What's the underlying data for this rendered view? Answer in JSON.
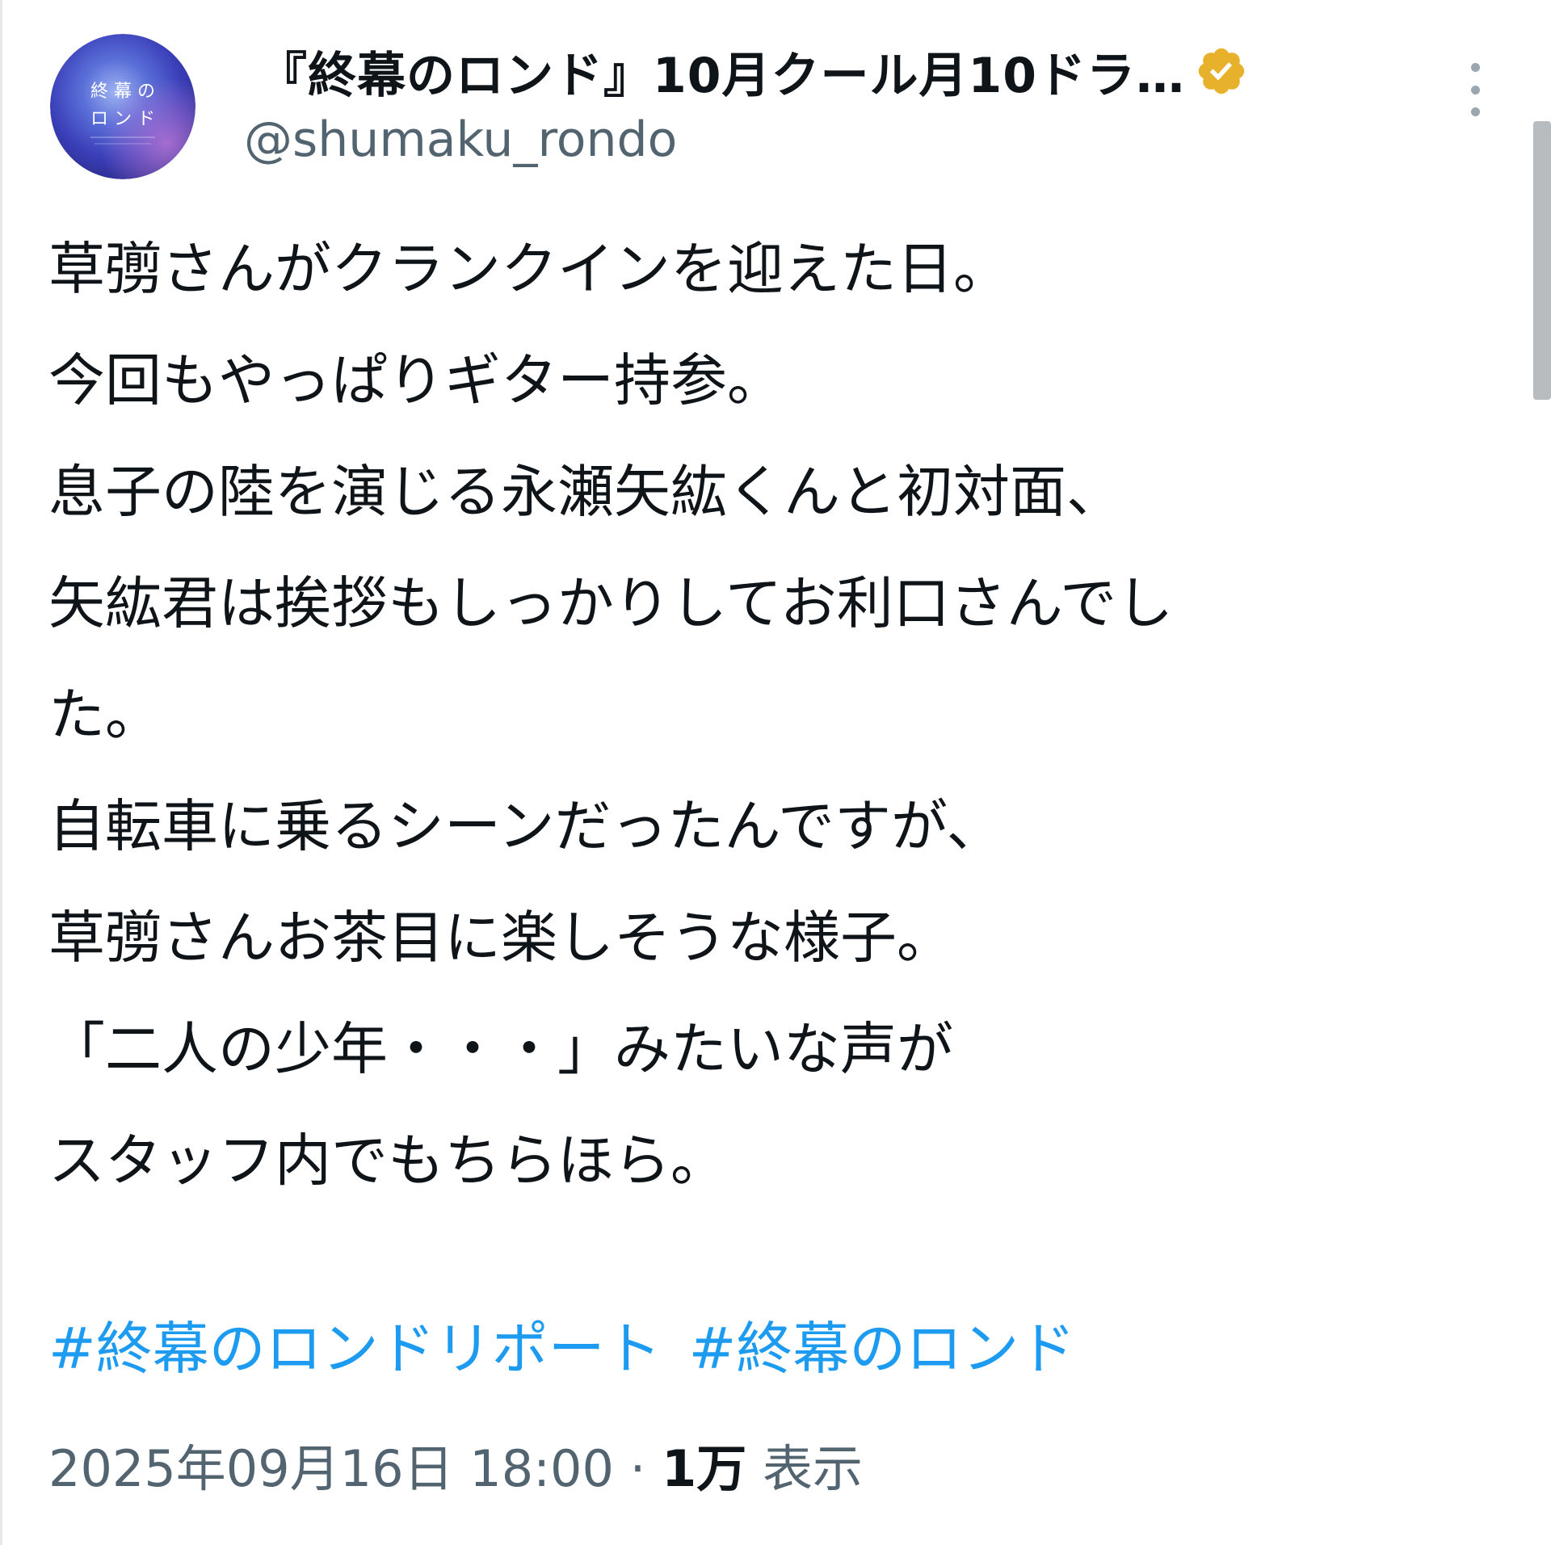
{
  "account": {
    "display_name": "『終幕のロンド』10月クール月10ドラ…",
    "handle": "@shumaku_rondo",
    "verified": true,
    "avatar_text_line1": "終 幕 の",
    "avatar_text_line2": "ロ ン ド"
  },
  "tweet": {
    "lines": [
      "草彅さんがクランクインを迎えた日。",
      "今回もやっぱりギター持参。",
      "息子の陸を演じる永瀬矢紘くんと初対面、",
      "矢紘君は挨拶もしっかりしてお利口さんでし",
      "た。",
      "自転車に乗るシーンだったんですが、",
      "草彅さんお茶目に楽しそうな様子。",
      "「二人の少年・・・」みたいな声が",
      "スタッフ内でもちらほら。"
    ],
    "hashtags": [
      "#終幕のロンドリポート",
      "#終幕のロンド"
    ]
  },
  "meta": {
    "timestamp": "2025年09月16日 18:00",
    "separator": "·",
    "views_count": "1万",
    "views_label": "表示"
  },
  "colors": {
    "text": "#0f1419",
    "secondary": "#536471",
    "link": "#1d9bf0",
    "verified_gold": "#e8b12b"
  },
  "icons": {
    "verified": "verified-badge-icon",
    "more": "more-vertical-icon"
  }
}
